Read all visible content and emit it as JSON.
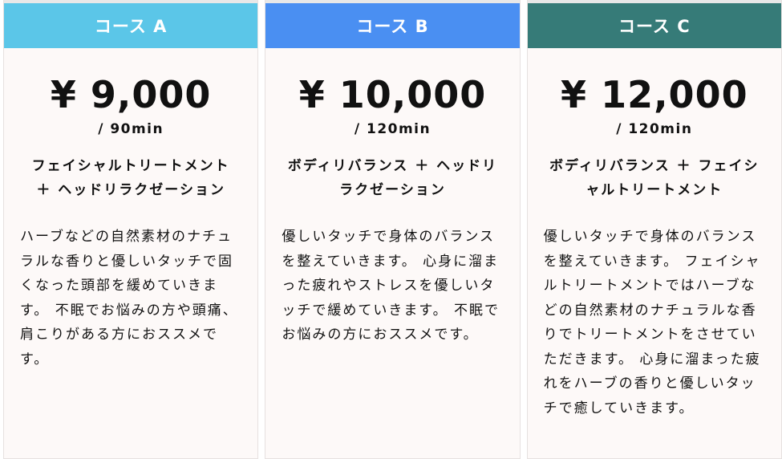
{
  "plans": [
    {
      "name": "コース A",
      "price": "¥ 9,000",
      "duration": "/ 90min",
      "title": "フェイシャルトリートメント ＋ ヘッドリラクゼーション",
      "description": "ハーブなどの自然素材のナチュラルな香りと優しいタッチで固くなった頭部を緩めていきます。 不眠でお悩みの方や頭痛、肩こりがある方におススメです。",
      "color": "#5bc6e8"
    },
    {
      "name": "コース B",
      "price": "¥ 10,000",
      "duration": "/ 120min",
      "title": "ボディリバランス ＋ ヘッドリラクゼーション",
      "description": "優しいタッチで身体のバランスを整えていきます。 心身に溜まった疲れやストレスを優しいタッチで緩めていきます。 不眠でお悩みの方におススメです。",
      "color": "#4a8ff2"
    },
    {
      "name": "コース C",
      "price": "¥ 12,000",
      "duration": "/ 120min",
      "title": "ボディリバランス ＋ フェイシャルトリートメント",
      "description": "優しいタッチで身体のバランスを整えていきます。 フェイシャルトリートメントではハーブなどの自然素材のナチュラルな香りでトリートメントをさせていただきます。 心身に溜まった疲れをハーブの香りと優しいタッチで癒していきます。",
      "color": "#367b78"
    }
  ]
}
